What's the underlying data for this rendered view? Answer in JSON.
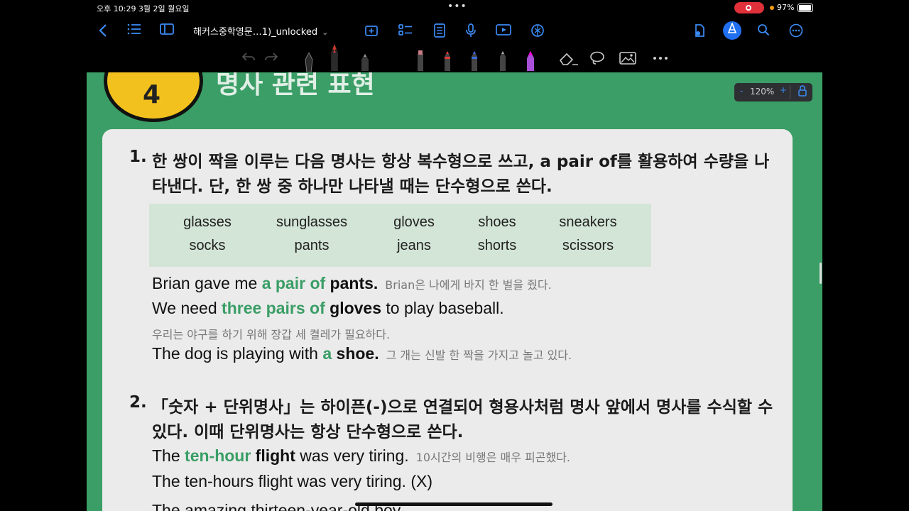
{
  "status": {
    "time": "오후 10:29  3월 2일 월요일",
    "dots": "•••",
    "battery": "97%"
  },
  "nav": {
    "doc_title": "해커스중학영문…1)_unlocked",
    "caret": "⌄"
  },
  "zoom": {
    "minus": "-",
    "percent": "120%",
    "plus": "+"
  },
  "page": {
    "badge_number": "4",
    "heading": "명사 관련 표현"
  },
  "rule1": {
    "num": "1.",
    "line1": "한 쌍이 짝을 이루는 다음 명사는 항상 복수형으로 쓰고, a pair of를 활용하여 수량을 나",
    "line2": "타낸다. 단, 한 쌍 중 하나만 나타낼 때는 단수형으로 쓴다."
  },
  "words": [
    [
      "glasses",
      "sunglasses",
      "gloves",
      "shoes",
      "sneakers"
    ],
    [
      "socks",
      "pants",
      "jeans",
      "shorts",
      "scissors"
    ]
  ],
  "examples1": {
    "e1": {
      "a": "Brian gave me ",
      "g": "a pair of",
      "b": " pants.",
      "ko": "Brian은 나에게 바지 한 벌을 줬다."
    },
    "e2": {
      "a": "We need ",
      "g": "three pairs of",
      "b": " gloves",
      "c": " to play baseball."
    },
    "e2_ko": "우리는 야구를 하기 위해 장갑 세 켤레가 필요하다.",
    "e3": {
      "a": "The dog is playing with ",
      "g": "a",
      "b": " shoe.",
      "ko": "그 개는 신발 한 짝을 가지고 놀고 있다."
    }
  },
  "rule2": {
    "num": "2.",
    "line1": "「숫자 + 단위명사」는 하이픈(-)으로 연결되어 형용사처럼 명사 앞에서 명사를 수식할 수",
    "line2": "있다. 이때 단위명사는 항상 단수형으로 쓴다."
  },
  "examples2": {
    "e1": {
      "a": "The ",
      "g": "ten-hour",
      "b": " flight",
      "c": " was very tiring.",
      "ko": "10시간의 비행은 매우 피곤했다."
    },
    "e2": "The ten-hours flight was very tiring. (X)",
    "e3": "The amazing thirteen-year-old boy"
  },
  "colors": {
    "green": "#3a9e66",
    "accent": "#3b8bf5",
    "badge": "#f2c11d"
  }
}
